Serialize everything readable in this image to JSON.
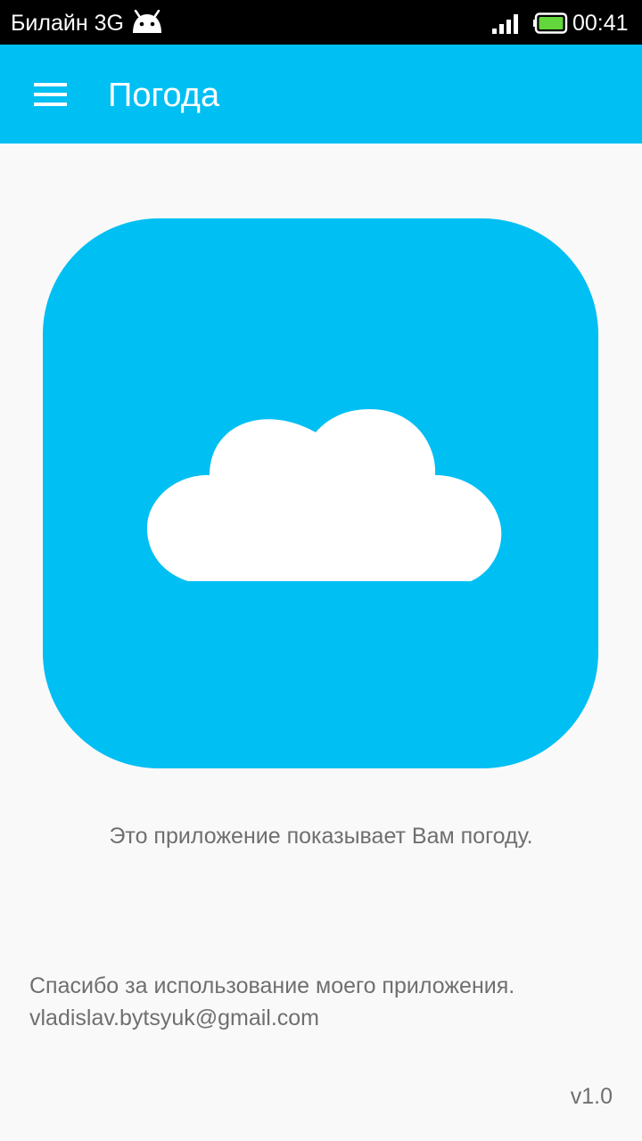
{
  "status_bar": {
    "carrier": "Билайн 3G",
    "time": "00:41",
    "icons": [
      "android-icon",
      "signal-icon",
      "battery-icon"
    ],
    "battery_color": "#62d63a"
  },
  "app_bar": {
    "title": "Погода",
    "menu_icon": "hamburger-menu-icon",
    "background": "#00bff3"
  },
  "logo": {
    "icon": "cloud-icon",
    "background": "#00bff3"
  },
  "content": {
    "description": "Это приложение показывает Вам погоду.",
    "thanks": "Спасибо за использование моего приложения.",
    "email": "vladislav.bytsyuk@gmail.com",
    "version": "v1.0"
  }
}
